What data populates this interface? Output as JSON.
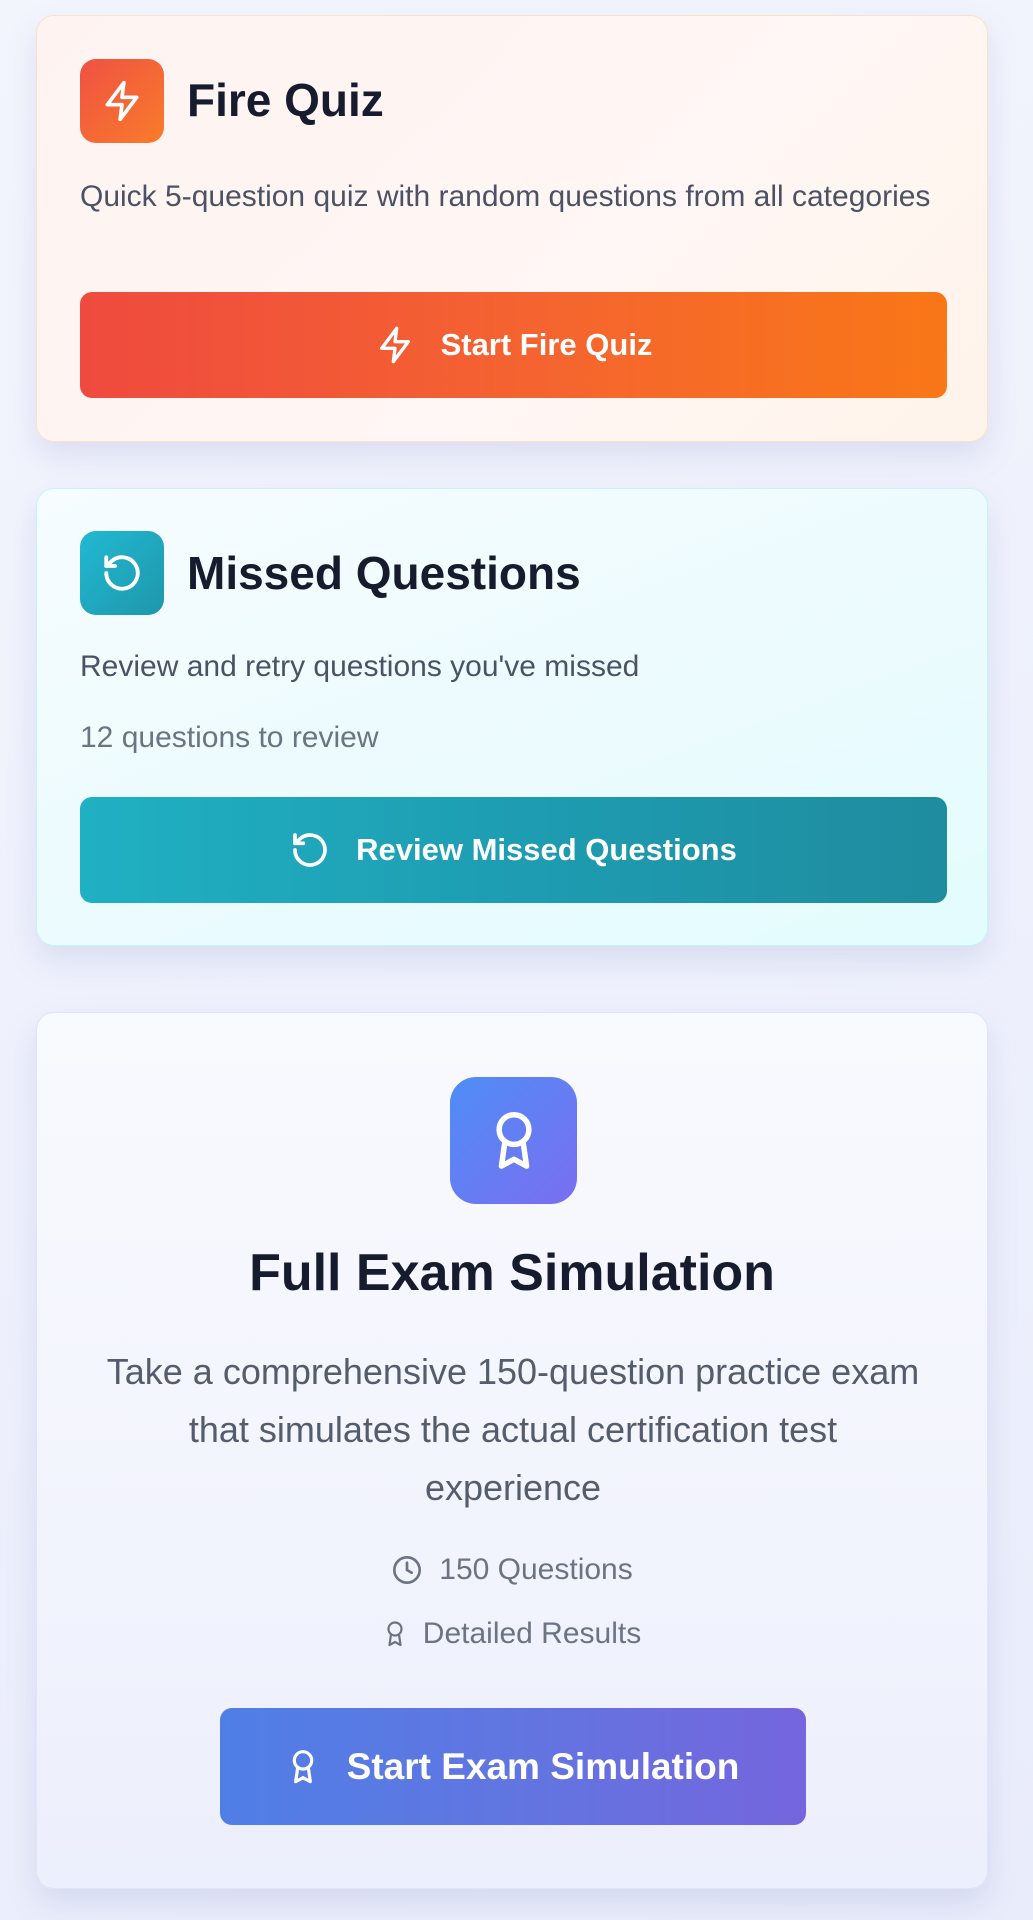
{
  "fire_quiz": {
    "icon": "lightning-icon",
    "title": "Fire Quiz",
    "description": "Quick 5-question quiz with random questions from all categories",
    "button_label": "Start Fire Quiz",
    "colors": {
      "accent_start": "#ef4a3f",
      "accent_end": "#f97717"
    }
  },
  "missed_questions": {
    "icon": "retry-icon",
    "title": "Missed Questions",
    "description": "Review and retry questions you've missed",
    "count_text": "12 questions to review",
    "button_label": "Review Missed Questions",
    "colors": {
      "accent_start": "#20b0c3",
      "accent_end": "#1f8c9f"
    }
  },
  "exam_simulation": {
    "icon": "award-icon",
    "title": "Full Exam Simulation",
    "description": "Take a comprehensive 150-question practice exam that simulates the actual certification test experience",
    "features": [
      {
        "icon": "clock-icon",
        "label": "150 Questions"
      },
      {
        "icon": "award-icon",
        "label": "Detailed Results"
      }
    ],
    "button_label": "Start Exam Simulation",
    "colors": {
      "accent_start": "#4f7fe6",
      "accent_end": "#7565de"
    }
  }
}
